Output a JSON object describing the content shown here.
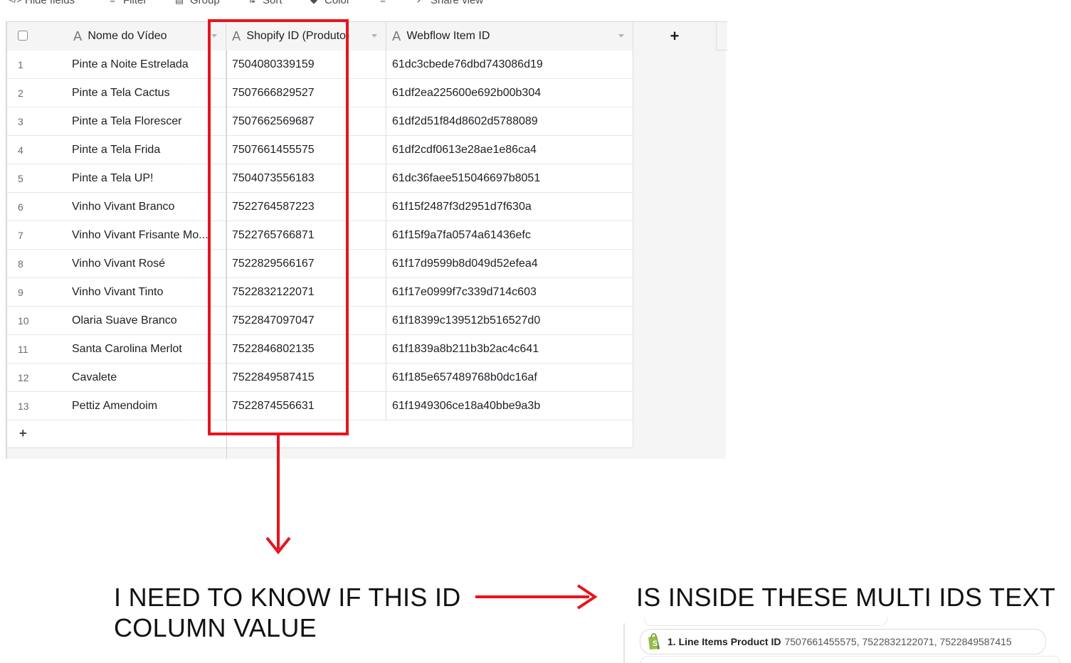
{
  "toolbar": {
    "hide_fields": "Hide fields",
    "filter": "Filter",
    "group": "Group",
    "sort": "Sort",
    "color": "Color",
    "share_view": "Share view"
  },
  "table": {
    "columns": [
      {
        "name": "Nome do Vídeo",
        "type_icon": "text-field-icon"
      },
      {
        "name": "Shopify ID (Produto)",
        "type_icon": "text-field-icon"
      },
      {
        "name": "Webflow Item ID",
        "type_icon": "text-field-icon"
      }
    ],
    "add_column": "+",
    "add_row": "+",
    "rows": [
      {
        "n": "1",
        "name": "Pinte a Noite Estrelada",
        "shopify": "7504080339159",
        "webflow": "61dc3cbede76dbd743086d19"
      },
      {
        "n": "2",
        "name": "Pinte a Tela Cactus",
        "shopify": "7507666829527",
        "webflow": "61df2ea225600e692b00b304"
      },
      {
        "n": "3",
        "name": "Pinte a Tela Florescer",
        "shopify": "7507662569687",
        "webflow": "61df2d51f84d8602d5788089"
      },
      {
        "n": "4",
        "name": "Pinte a Tela Frida",
        "shopify": "7507661455575",
        "webflow": "61df2cdf0613e28ae1e86ca4"
      },
      {
        "n": "5",
        "name": "Pinte a Tela UP!",
        "shopify": "7504073556183",
        "webflow": "61dc36faee515046697b8051"
      },
      {
        "n": "6",
        "name": "Vinho Vivant Branco",
        "shopify": "7522764587223",
        "webflow": "61f15f2487f3d2951d7f630a"
      },
      {
        "n": "7",
        "name": "Vinho Vivant Frisante Mo...",
        "shopify": "7522765766871",
        "webflow": "61f15f9a7fa0574a61436efc"
      },
      {
        "n": "8",
        "name": "Vinho Vivant Rosé",
        "shopify": "7522829566167",
        "webflow": "61f17d9599b8d049d52efea4"
      },
      {
        "n": "9",
        "name": "Vinho Vivant Tinto",
        "shopify": "7522832122071",
        "webflow": "61f17e0999f7c339d714c603"
      },
      {
        "n": "10",
        "name": "Olaria Suave Branco",
        "shopify": "7522847097047",
        "webflow": "61f18399c139512b516527d0"
      },
      {
        "n": "11",
        "name": "Santa Carolina Merlot",
        "shopify": "7522846802135",
        "webflow": "61f1839a8b211b3b2ac4c641"
      },
      {
        "n": "12",
        "name": "Cavalete",
        "shopify": "7522849587415",
        "webflow": "61f185e657489768b0dc16af"
      },
      {
        "n": "13",
        "name": "Pettiz Amendoim",
        "shopify": "7522874556631",
        "webflow": "61f1949306ce18a40bbe9a3b"
      }
    ]
  },
  "annotations": {
    "left_text_line1": "I NEED TO KNOW IF THIS ID",
    "left_text_line2": "COLUMN VALUE",
    "right_text": "IS INSIDE  THESE MULTI IDS TEXT",
    "highlight_color": "#e8141c"
  },
  "zap_field": {
    "label": "1. Line Items Product ID",
    "value": "7507661455575, 7522832122071, 7522849587415",
    "icon": "shopify-icon"
  }
}
